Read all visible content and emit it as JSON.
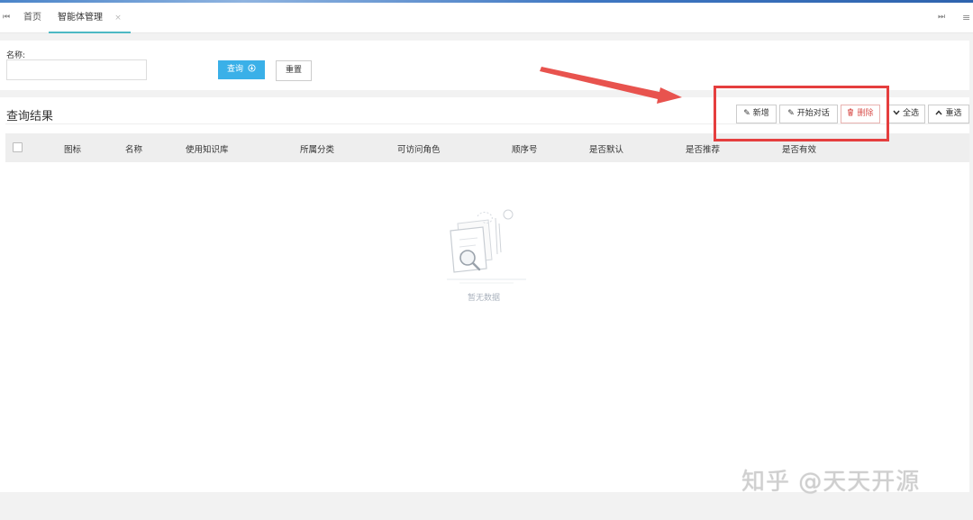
{
  "tabs": {
    "home": "首页",
    "active": "智能体管理",
    "close": "×",
    "prev": "⏮",
    "next": "⏭",
    "menu": "≡"
  },
  "search": {
    "name_label": "名称:",
    "name_value": "",
    "query_label": "查询",
    "reset_label": "重置"
  },
  "results": {
    "title": "查询结果",
    "toolbar": {
      "add": "新增",
      "start_chat": "开始对话",
      "delete": "删除",
      "select_all": "全选",
      "reselect": "重选"
    },
    "columns": [
      "图标",
      "名称",
      "使用知识库",
      "所属分类",
      "可访问角色",
      "顺序号",
      "是否默认",
      "是否推荐",
      "是否有效"
    ],
    "empty_text": "暂无数据"
  },
  "watermark": "知乎 @天天开源",
  "colors": {
    "primary": "#3ab0e8",
    "danger": "#d9534f",
    "annotation": "#e53e3e",
    "tab_accent": "#4cb8c4"
  }
}
